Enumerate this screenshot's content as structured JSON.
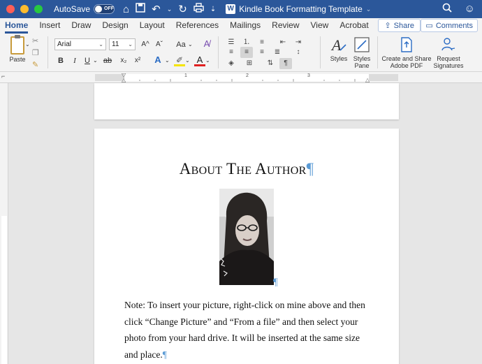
{
  "titlebar": {
    "autosave_label": "AutoSave",
    "autosave_state": "OFF",
    "document_title": "Kindle Book Formatting Template"
  },
  "tabs": [
    "Home",
    "Insert",
    "Draw",
    "Design",
    "Layout",
    "References",
    "Mailings",
    "Review",
    "View",
    "Acrobat"
  ],
  "active_tab": "Home",
  "share_label": "Share",
  "comments_label": "Comments",
  "ribbon": {
    "paste_label": "Paste",
    "font_name": "Arial",
    "font_size": "11",
    "styles_label": "Styles",
    "styles_pane_label_1": "Styles",
    "styles_pane_label_2": "Pane",
    "create_pdf_label_1": "Create and Share",
    "create_pdf_label_2": "Adobe PDF",
    "request_sig_label_1": "Request",
    "request_sig_label_2": "Signatures",
    "bold": "B",
    "italic": "I",
    "underline": "U",
    "strike": "ab",
    "subscript": "x₂",
    "superscript": "x²",
    "grow_font": "A^",
    "shrink_font": "Aˇ",
    "change_case": "Aa",
    "pilcrow": "¶"
  },
  "ruler": {
    "marks": [
      "1",
      "2",
      "3"
    ]
  },
  "document": {
    "heading": "About The Author",
    "pilcrow": "¶",
    "body_lines": [
      "Note: To insert your picture, right-click on mine above and then",
      "click “Change Picture” and “From a file” and then select your",
      "photo from your hard drive. It will be inserted at the same size",
      "and place."
    ]
  },
  "colors": {
    "title_bar": "#2b579a",
    "accent": "#2b579a",
    "formatting_mark": "#5b9bd5"
  }
}
